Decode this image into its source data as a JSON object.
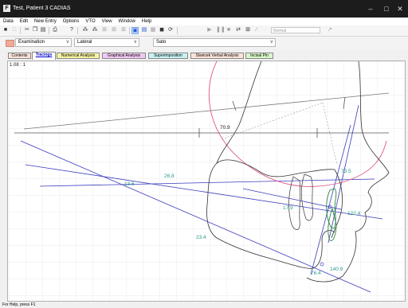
{
  "window": {
    "title": "Test, Patient 3 CADIAS",
    "icon_letter": "F",
    "minimize_glyph": "–",
    "maximize_glyph": "□",
    "close_glyph": "✕"
  },
  "menu": [
    "Data",
    "Edit",
    "New Entry",
    "Options",
    "VTO",
    "View",
    "Window",
    "Help"
  ],
  "toolbar": {
    "line_style_value": "Normal"
  },
  "options": {
    "mode": "Examination",
    "view": "Lateral",
    "analysis": "Sato",
    "dropdown_glyph": "∨",
    "accent_color": "#f3a995"
  },
  "tabs": [
    {
      "label": "Contents",
      "color": "#fbe3d8",
      "active": false
    },
    {
      "label": "Tracings",
      "color": "#ffffff",
      "active": true
    },
    {
      "label": "Numerical Analysis",
      "color": "#f5f5a0",
      "active": false
    },
    {
      "label": "Graphical Analysis",
      "color": "#f2c8f2",
      "active": false
    },
    {
      "label": "Superimposition",
      "color": "#c8f2f2",
      "active": false
    },
    {
      "label": "Slavicek Verbal Analysis",
      "color": "#fbe3d8",
      "active": false
    },
    {
      "label": "Incisal Pin",
      "color": "#d8f7c8",
      "active": false
    }
  ],
  "canvas": {
    "scale": "1.08 : 1",
    "measurements": {
      "m1": {
        "value": "70.9",
        "color": "#222222"
      },
      "m2": {
        "value": "26.8",
        "color": "#2a9a8a"
      },
      "m3": {
        "value": "13.6",
        "color": "#2a9a8a"
      },
      "m4": {
        "value": "73.5",
        "color": "#2a9a8a"
      },
      "m5": {
        "value": "17.9",
        "color": "#2a9a8a"
      },
      "m6": {
        "value": "122.4",
        "color": "#2a9a8a"
      },
      "m7": {
        "value": "23.4",
        "color": "#2a9a8a"
      },
      "m8": {
        "value": "76.4",
        "color": "#2a9a8a"
      },
      "m9": {
        "value": "140.9",
        "color": "#2a9a8a"
      }
    }
  },
  "status": {
    "text": "For Help, press F1"
  }
}
